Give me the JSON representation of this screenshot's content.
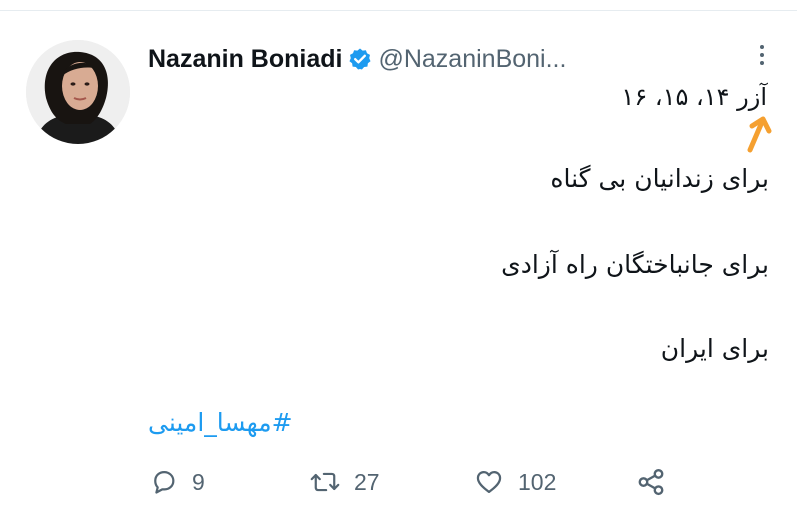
{
  "tweet": {
    "author": {
      "display_name": "Nazanin Boniadi",
      "handle": "@NazaninBoni...",
      "verified": true,
      "avatar": "profile-photo"
    },
    "date": "آزر ۱۴، ۱۵، ۱۶",
    "lines": [
      "برای زندانیان بی گناه",
      "برای جانباختگان راه آزادی",
      "برای ایران"
    ],
    "hashtag": "#مهسا_امینی",
    "actions": {
      "reply": {
        "icon": "reply-icon",
        "count": "9"
      },
      "retweet": {
        "icon": "retweet-icon",
        "count": "27"
      },
      "like": {
        "icon": "heart-icon",
        "count": "102"
      },
      "share": {
        "icon": "share-icon"
      }
    },
    "colors": {
      "link": "#1d9bf0",
      "verified": "#1d9bf0",
      "annotation_arrow": "#f5a030",
      "secondary_text": "#536471"
    }
  }
}
